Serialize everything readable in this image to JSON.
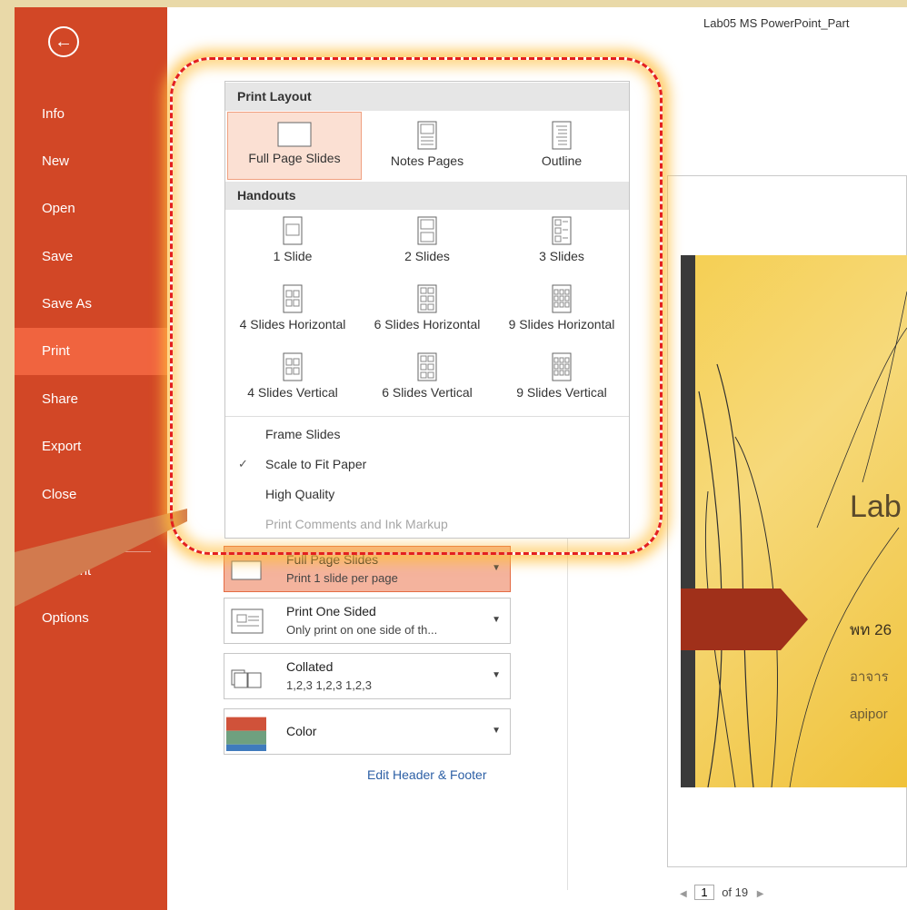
{
  "window": {
    "doc_title": "Lab05 MS PowerPoint_Part"
  },
  "sidebar": {
    "back_icon": "back-arrow-icon",
    "items": [
      {
        "label": "Info"
      },
      {
        "label": "New"
      },
      {
        "label": "Open"
      },
      {
        "label": "Save"
      },
      {
        "label": "Save As"
      },
      {
        "label": "Print",
        "active": true
      },
      {
        "label": "Share"
      },
      {
        "label": "Export"
      },
      {
        "label": "Close"
      },
      {
        "label": "Account"
      },
      {
        "label": "Options"
      }
    ],
    "colors": {
      "bg": "#d24726",
      "active": "#f0643f"
    }
  },
  "popup": {
    "print_layout_header": "Print Layout",
    "layouts": [
      {
        "label": "Full Page Slides",
        "selected": true
      },
      {
        "label": "Notes Pages"
      },
      {
        "label": "Outline"
      }
    ],
    "handouts_header": "Handouts",
    "handouts": [
      {
        "label": "1 Slide"
      },
      {
        "label": "2 Slides"
      },
      {
        "label": "3 Slides"
      },
      {
        "label": "4 Slides Horizontal"
      },
      {
        "label": "6 Slides Horizontal"
      },
      {
        "label": "9 Slides Horizontal"
      },
      {
        "label": "4 Slides Vertical"
      },
      {
        "label": "6 Slides Vertical"
      },
      {
        "label": "9 Slides Vertical"
      }
    ],
    "options": {
      "frame_slides": "Frame Slides",
      "scale_to_fit": "Scale to Fit Paper",
      "scale_checked": true,
      "high_quality": "High Quality",
      "print_comments": "Print Comments and Ink Markup"
    }
  },
  "settings": {
    "layout": {
      "title": "Full Page Slides",
      "subtitle": "Print 1 slide per page"
    },
    "sided": {
      "title": "Print One Sided",
      "subtitle": "Only print on one side of th..."
    },
    "collation": {
      "title": "Collated",
      "subtitle": "1,2,3   1,2,3   1,2,3"
    },
    "color": {
      "title": "Color"
    },
    "edit_header_footer": "Edit Header & Footer"
  },
  "preview": {
    "slide_title": "Lab",
    "slide_date": "พท 26",
    "slide_author": "อาจาร",
    "slide_email": "apipor",
    "page_current": "1",
    "page_total": "of 19"
  }
}
